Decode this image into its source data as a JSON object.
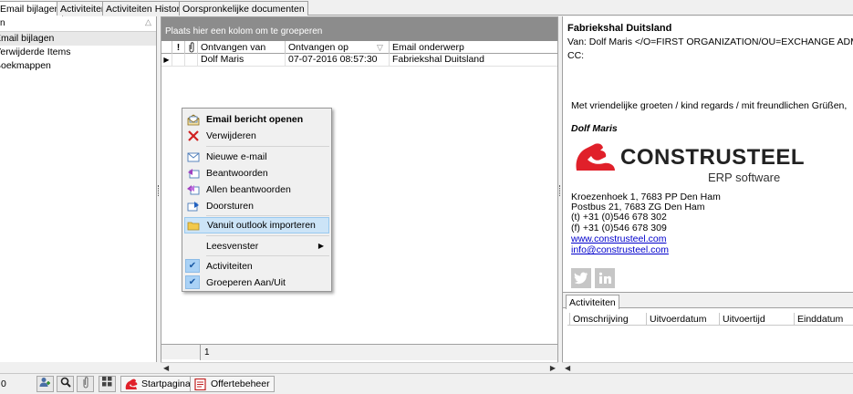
{
  "tabs": [
    {
      "label": "Email bijlagen",
      "active": true
    },
    {
      "label": "Activiteiten",
      "active": false
    },
    {
      "label": "Activiteiten Historie",
      "active": false
    },
    {
      "label": "Oorspronkelijke documenten",
      "active": false
    }
  ],
  "tree": {
    "header": "n",
    "items": [
      {
        "label": "Email bijlagen",
        "selected": true
      },
      {
        "label": "Verwijderde Items",
        "selected": false
      },
      {
        "label": "Boekmappen",
        "selected": false
      }
    ]
  },
  "grid": {
    "group_hint": "Plaats hier een kolom om te groeperen",
    "columns": [
      "!",
      "",
      "Ontvangen van",
      "Ontvangen op",
      "Email onderwerp"
    ],
    "rows": [
      {
        "from": "Dolf Maris",
        "received": "07-07-2016 08:57:30",
        "subject": "Fabriekshal Duitsland"
      }
    ],
    "page_number": "1"
  },
  "context_menu": {
    "items": [
      {
        "label": "Email bericht openen",
        "icon": "open-mail-icon"
      },
      {
        "label": "Verwijderen",
        "icon": "delete-x-icon"
      },
      {
        "label": "Nieuwe e-mail",
        "icon": "new-mail-icon"
      },
      {
        "label": "Beantwoorden",
        "icon": "reply-icon"
      },
      {
        "label": "Allen beantwoorden",
        "icon": "reply-all-icon"
      },
      {
        "label": "Doorsturen",
        "icon": "forward-icon"
      },
      {
        "label": "Vanuit outlook importeren",
        "icon": "import-folder-icon"
      },
      {
        "label": "Leesvenster",
        "icon": ""
      },
      {
        "label": "Activiteiten",
        "icon": "check-icon"
      },
      {
        "label": "Groeperen Aan/Uit",
        "icon": "check-icon"
      }
    ]
  },
  "preview": {
    "subject": "Fabriekshal Duitsland",
    "from_line": "Van: Dolf Maris </O=FIRST ORGANIZATION/OU=EXCHANGE ADMINI",
    "cc_line": "CC:",
    "greeting": "Met vriendelijke groeten / kind regards / mit freundlichen Grüßen,",
    "signature_name": "Dolf Maris",
    "logo_text": "CONSTRUSTEEL",
    "logo_sub": "ERP software",
    "address_lines": [
      "Kroezenhoek 1, 7683 PP Den Ham",
      "Postbus 21, 7683 ZG Den Ham",
      "(t) +31 (0)546 678 302",
      "(f) +31 (0)546 678 309"
    ],
    "website": "www.construsteel.com",
    "email": "info@construsteel.com",
    "social": [
      "twitter-icon",
      "linkedin-icon"
    ]
  },
  "activities": {
    "tab": "Activiteiten",
    "columns": [
      "Omschrijving",
      "Uitvoerdatum",
      "Uitvoertijd",
      "Einddatum"
    ]
  },
  "statusbar": {
    "count": "0",
    "tabs": [
      "Startpagina",
      "Offertebeheer"
    ]
  },
  "colors": {
    "group_bar": "#8c8c8c",
    "brand_red": "#e0202a",
    "highlight": "#cce4f7",
    "link": "#0000cc"
  }
}
